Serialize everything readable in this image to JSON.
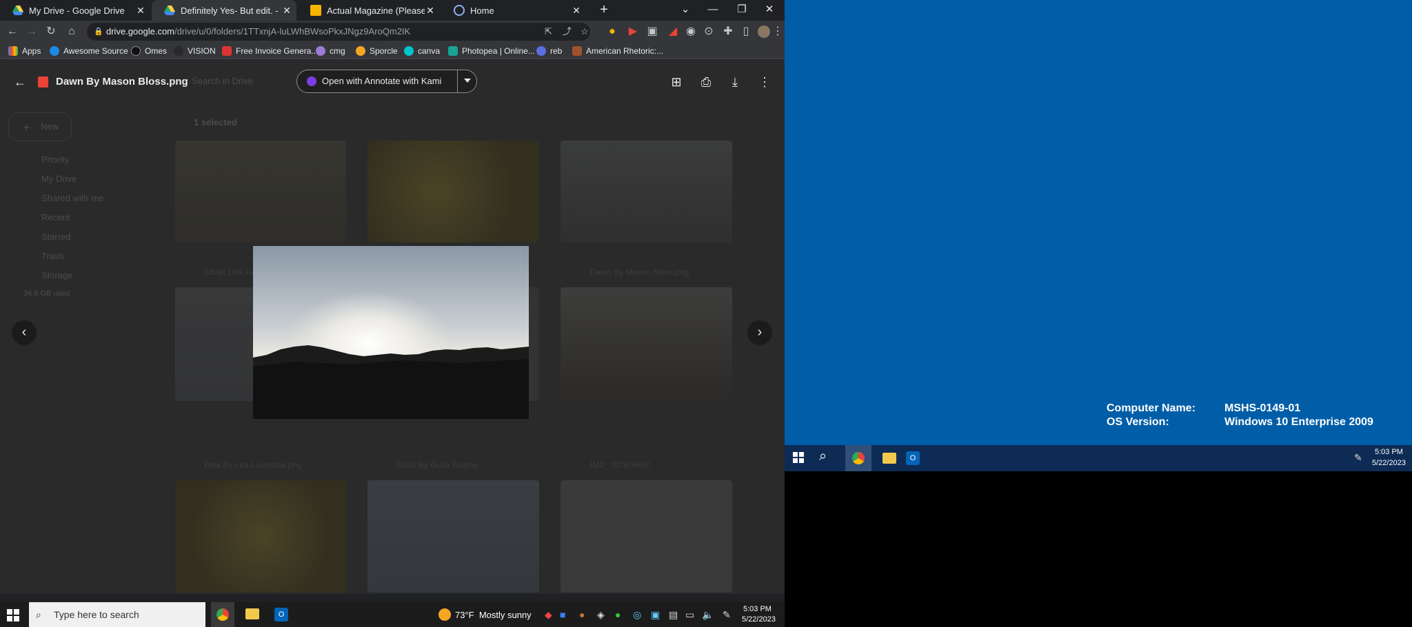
{
  "browser": {
    "tabs": [
      {
        "title": "My Drive - Google Drive"
      },
      {
        "title": "Definitely Yes- But edit. - Google"
      },
      {
        "title": "Actual Magazine (Please Touch)"
      },
      {
        "title": "Home"
      }
    ],
    "url_host": "drive.google.com",
    "url_path": "/drive/u/0/folders/1TTxnjA-luLWhBWsoPkxJNgz9AroQm2IK",
    "bookmarks": [
      "Apps",
      "Awesome Source",
      "Omes",
      "VISION",
      "Free Invoice Genera...",
      "cmg",
      "Sporcle",
      "canva",
      "Photopea | Online...",
      "reb",
      "American Rhetoric:..."
    ]
  },
  "drive": {
    "search_placeholder": "Search in Drive",
    "new_label": "New",
    "selected_label": "1 selected",
    "sidebar": [
      "Priority",
      "My Drive",
      "Shared with me",
      "Recent",
      "Starred",
      "Trash",
      "Storage"
    ],
    "storage_used": "36.8 GB used",
    "files": [
      "Chain Link Fe...",
      "Dawn By Mason Bloss.png",
      "Dew By Lea Lurconda.png",
      "Dusk By Gulia Seamy",
      "IMG_2076.HEIC"
    ]
  },
  "viewer": {
    "file_title": "Dawn By Mason Bloss.png",
    "open_with_label": "Open with Annotate with Kami"
  },
  "taskbar_left": {
    "search_placeholder": "Type here to search",
    "weather": "73°F  Mostly sunny",
    "time": "5:03 PM",
    "date": "5/22/2023"
  },
  "desktop_right": {
    "computer_name_label": "Computer Name:",
    "computer_name_value": "MSHS-0149-01",
    "os_label": "OS Version:",
    "os_value": "Windows 10 Enterprise 2009",
    "time": "5:03 PM",
    "date": "5/22/2023"
  },
  "colors": {
    "desktop_blue": "#005ea8",
    "browser_dark": "#202124"
  }
}
